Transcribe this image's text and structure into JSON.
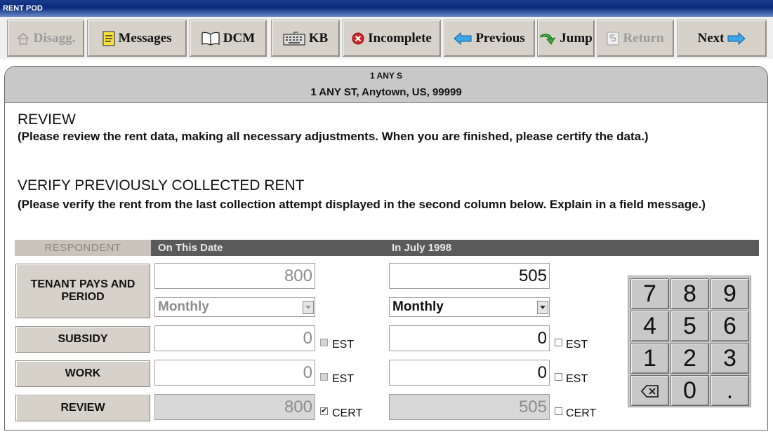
{
  "window": {
    "title": "RENT POD"
  },
  "toolbar": {
    "disagg": "Disagg.",
    "messages": "Messages",
    "dcm": "DCM",
    "kb": "KB",
    "incomplete": "Incomplete",
    "previous": "Previous",
    "jump": "Jump",
    "return": "Return",
    "next": "Next"
  },
  "address": {
    "line1": "1 ANY S",
    "line2": "1 ANY ST, Anytown, US, 99999"
  },
  "review": {
    "heading": "REVIEW",
    "instruction": "(Please review the rent data, making all necessary adjustments. When you are finished, please certify the data.)"
  },
  "verify": {
    "heading": "VERIFY PREVIOUSLY COLLECTED RENT",
    "instruction": "(Please verify the rent from the last collection attempt displayed in the second column below. Explain in a field message.)"
  },
  "columns": {
    "respondent": "RESPONDENT",
    "current": "On This Date",
    "previous": "In July 1998"
  },
  "rows": {
    "tenant": {
      "label": "TENANT PAYS AND PERIOD",
      "current": "800",
      "previous": "505",
      "current_period": "Monthly",
      "previous_period": "Monthly"
    },
    "subsidy": {
      "label": "SUBSIDY",
      "current": "0",
      "previous": "0",
      "flag": "EST",
      "current_checked": false,
      "previous_checked": false
    },
    "work": {
      "label": "WORK",
      "current": "0",
      "previous": "0",
      "flag": "EST",
      "current_checked": false,
      "previous_checked": false
    },
    "review": {
      "label": "REVIEW",
      "current": "800",
      "previous": "505",
      "flag": "CERT",
      "current_checked": true,
      "previous_checked": false
    }
  },
  "keypad": {
    "keys": [
      "7",
      "8",
      "9",
      "4",
      "5",
      "6",
      "1",
      "2",
      "3",
      "⌫",
      "0",
      "."
    ],
    "backspace_icon": "backspace-icon"
  }
}
